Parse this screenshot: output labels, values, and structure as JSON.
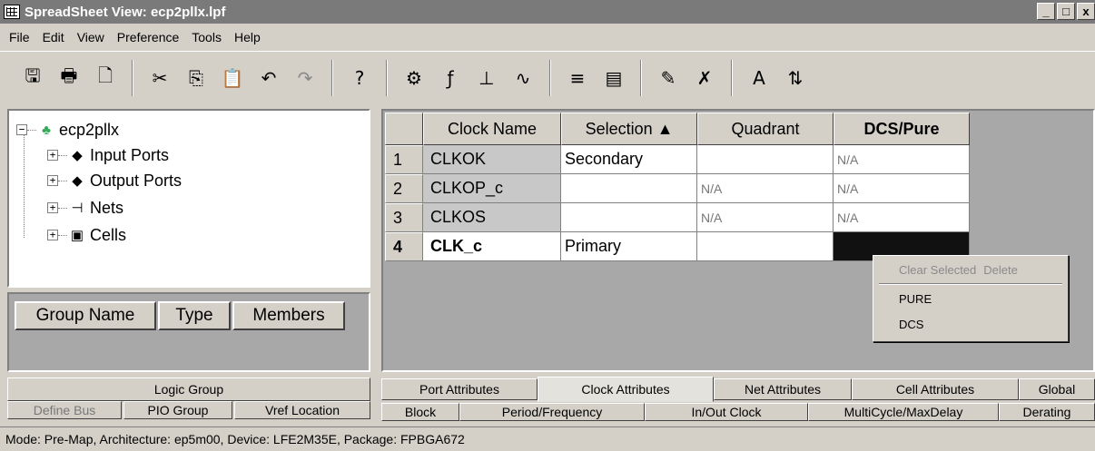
{
  "window": {
    "title": "SpreadSheet View: ecp2pllx.lpf",
    "controls": [
      "_",
      "□",
      "x"
    ]
  },
  "menu": [
    "File",
    "Edit",
    "View",
    "Preference",
    "Tools",
    "Help"
  ],
  "toolbar": {
    "groups": [
      [
        {
          "icon": "save-icon",
          "glyph": "🖫"
        },
        {
          "icon": "print-icon",
          "glyph": "🖶"
        },
        {
          "icon": "print-preview-icon",
          "glyph": "🗋"
        }
      ],
      [
        {
          "icon": "cut-icon",
          "glyph": "✂"
        },
        {
          "icon": "copy-icon",
          "glyph": "⎘"
        },
        {
          "icon": "paste-icon",
          "glyph": "📋"
        },
        {
          "icon": "undo-icon",
          "glyph": "↶"
        },
        {
          "icon": "redo-icon",
          "glyph": "↷"
        }
      ],
      [
        {
          "icon": "help-icon",
          "glyph": "?"
        }
      ],
      [
        {
          "icon": "clock-icon",
          "glyph": "⚙"
        },
        {
          "icon": "function-icon",
          "glyph": "ƒ"
        },
        {
          "icon": "timing-icon",
          "glyph": "⊥"
        },
        {
          "icon": "waveform-icon",
          "glyph": "∿"
        }
      ],
      [
        {
          "icon": "list-icon",
          "glyph": "≡"
        },
        {
          "icon": "cells-icon",
          "glyph": "▤"
        }
      ],
      [
        {
          "icon": "edit-icon",
          "glyph": "✎"
        },
        {
          "icon": "clear-icon",
          "glyph": "✗"
        }
      ],
      [
        {
          "icon": "font-icon",
          "glyph": "A"
        },
        {
          "icon": "sort-icon",
          "glyph": "⇅"
        }
      ]
    ]
  },
  "tree": {
    "root": "ecp2pllx",
    "items": [
      "Input Ports",
      "Output Ports",
      "Nets",
      "Cells"
    ]
  },
  "group_panel": {
    "headers": [
      "Group Name",
      "Type",
      "Members"
    ],
    "tab": "Logic Group",
    "tabs": [
      "Define Bus",
      "PIO Group",
      "Vref Location"
    ]
  },
  "grid": {
    "headers": [
      "Clock Name",
      "Selection ▲",
      "Quadrant",
      "DCS/Pure"
    ],
    "rows": [
      {
        "num": "1",
        "name": "CLKOK",
        "selection": "Secondary",
        "quadrant": "",
        "dcs": "N/A"
      },
      {
        "num": "2",
        "name": "CLKOP_c",
        "selection": "",
        "quadrant": "N/A",
        "dcs": "N/A"
      },
      {
        "num": "3",
        "name": "CLKOS",
        "selection": "",
        "quadrant": "N/A",
        "dcs": "N/A"
      },
      {
        "num": "4",
        "name": "CLK_c",
        "selection": "Primary",
        "quadrant": "",
        "dcs": ""
      }
    ]
  },
  "context_menu": {
    "clear_selected": "Clear Selected",
    "delete": "Delete",
    "items": [
      "PURE",
      "DCS"
    ]
  },
  "attr_tabs": [
    "Port Attributes",
    "Clock Attributes",
    "Net Attributes",
    "Cell Attributes",
    "Global"
  ],
  "sub_tabs": [
    "Block",
    "Period/Frequency",
    "In/Out Clock",
    "MultiCycle/MaxDelay",
    "Derating"
  ],
  "status": "Mode: Pre-Map,    Architecture: ep5m00, Device: LFE2M35E, Package: FPBGA672"
}
